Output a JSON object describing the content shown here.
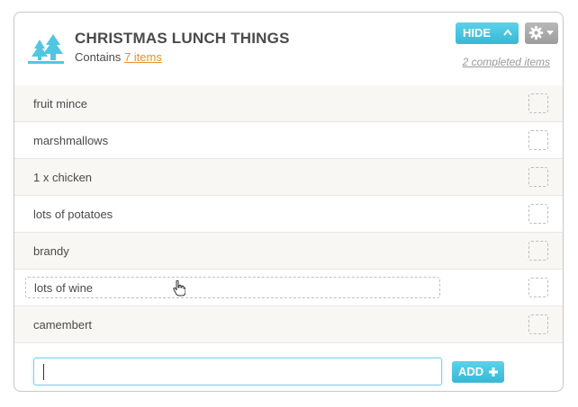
{
  "list": {
    "title": "CHRISTMAS LUNCH THINGS",
    "contains_prefix": "Contains",
    "items_link": "7 items",
    "completed_link": "2 completed items"
  },
  "header": {
    "hide_label": "HIDE",
    "icons": [
      "trees-icon",
      "chevron-up-icon",
      "gear-icon",
      "caret-down-icon"
    ],
    "accent_color": "#3fc1dd",
    "link_color": "#e8912e"
  },
  "items": [
    {
      "label": "fruit mince"
    },
    {
      "label": "marshmallows"
    },
    {
      "label": "1 x chicken"
    },
    {
      "label": "lots of potatoes"
    },
    {
      "label": "brandy"
    },
    {
      "label": "lots of wine"
    },
    {
      "label": "camembert"
    }
  ],
  "footer": {
    "input_value": "",
    "add_label": "ADD"
  }
}
